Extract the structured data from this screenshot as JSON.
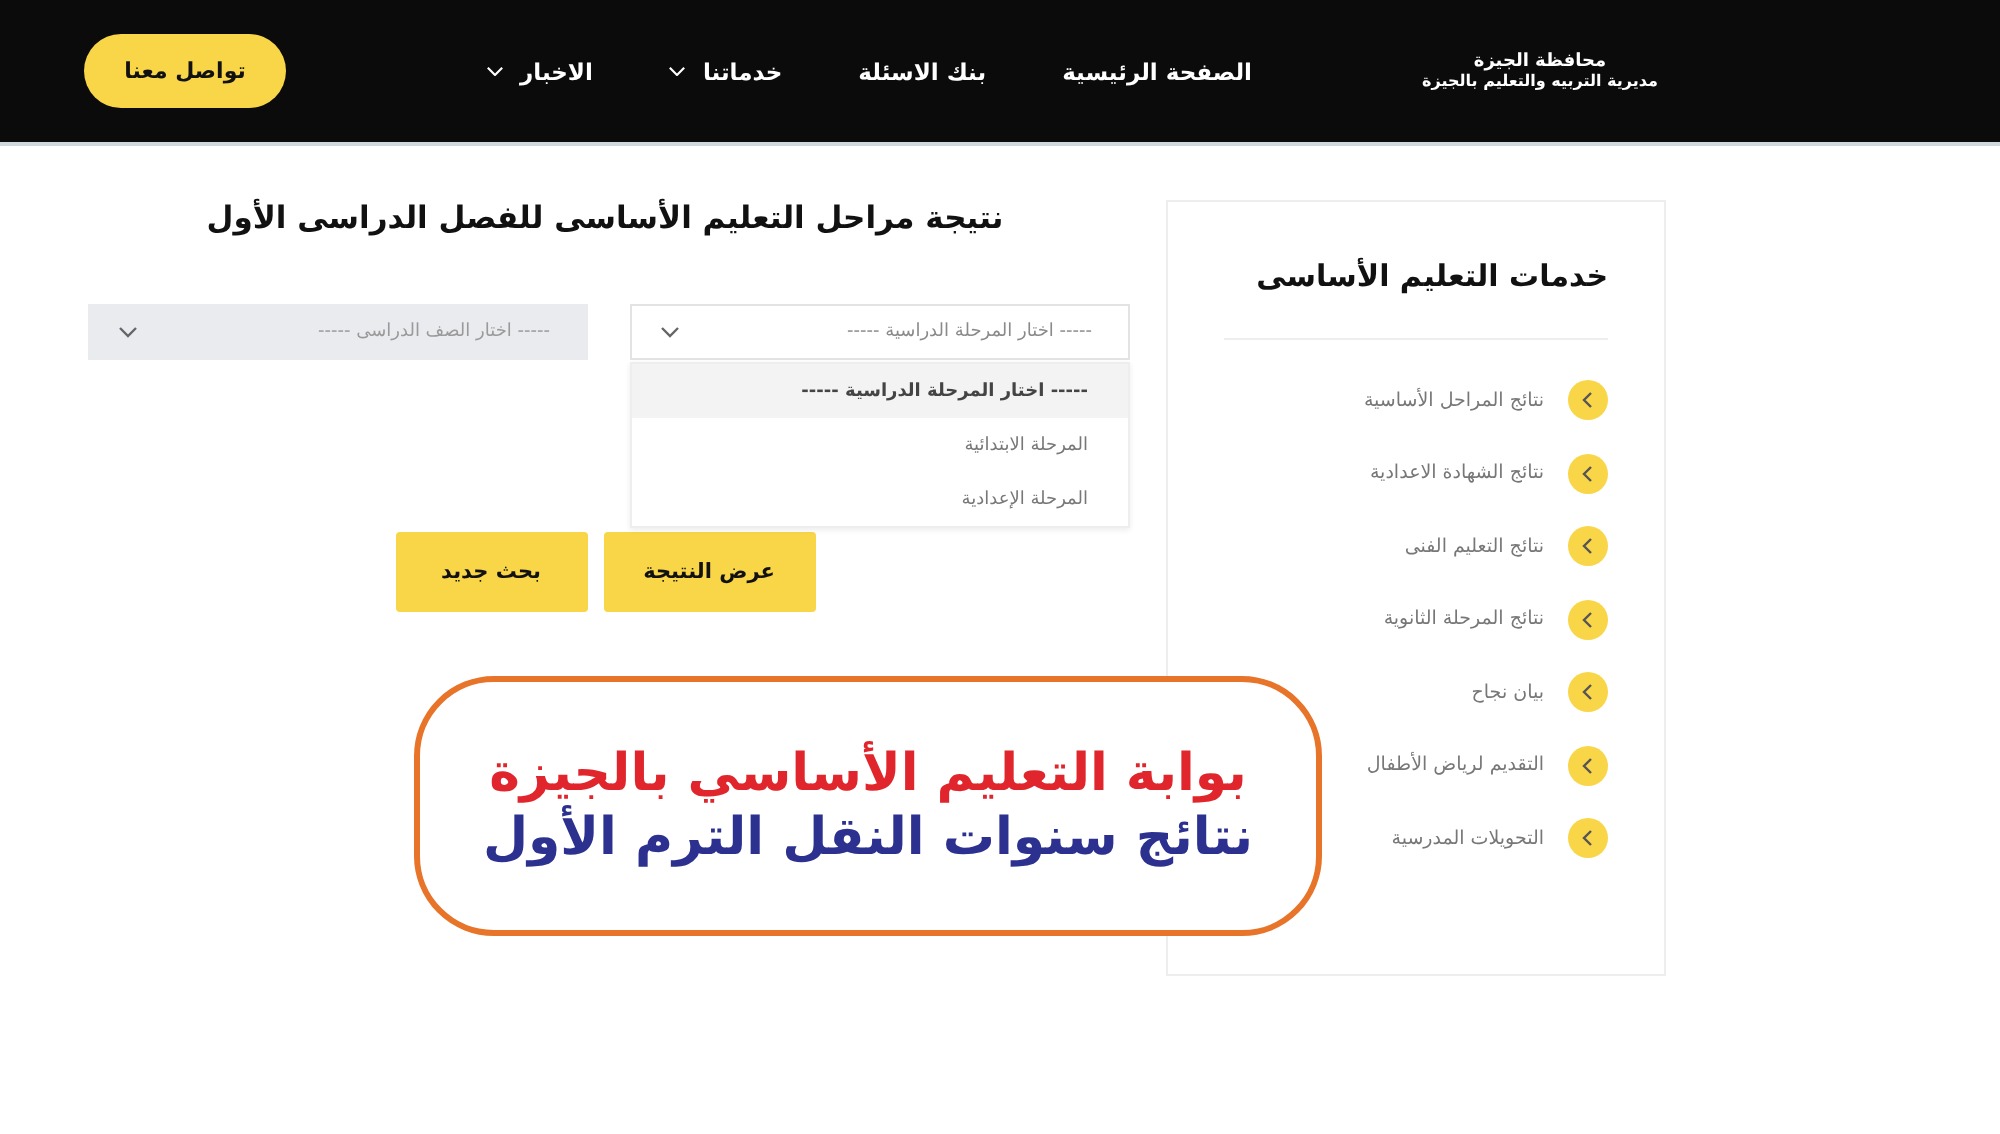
{
  "header": {
    "logo": {
      "line1": "محافظة الجيزة",
      "line2": "مديرية التربيه والتعليم بالجيزة"
    },
    "nav": [
      {
        "label": "الصفحة الرئيسية",
        "has_menu": false
      },
      {
        "label": "بنك الاسئلة",
        "has_menu": false
      },
      {
        "label": "خدماتنا",
        "has_menu": true
      },
      {
        "label": "الاخبار",
        "has_menu": true
      }
    ],
    "contact_button": "تواصل معنا"
  },
  "sidebar": {
    "title": "خدمات التعليم الأساسى",
    "items": [
      "نتائج المراحل الأساسية",
      "نتائج الشهادة الاعدادية",
      "نتائج التعليم الفنى",
      "نتائج المرحلة الثانوية",
      "بيان نجاح",
      "التقديم لرياض الأطفال",
      "التحويلات المدرسية"
    ]
  },
  "main": {
    "title": "نتيجة مراحل التعليم الأساسى للفصل الدراسى الأول",
    "selects": [
      {
        "value": "----- اختار المرحلة الدراسية -----",
        "disabled": false,
        "options": [
          {
            "label": "----- اختار المرحلة الدراسية -----",
            "selected": true
          },
          {
            "label": "المرحلة الابتدائية",
            "selected": false
          },
          {
            "label": "المرحلة الإعدادية",
            "selected": false
          }
        ]
      },
      {
        "value": "----- اختار الصف الدراسى -----",
        "disabled": true
      }
    ],
    "buttons": [
      "عرض النتيجة",
      "بحث جديد"
    ]
  },
  "overlay_banner": {
    "line1": "بوابة التعليم الأساسي بالجيزة",
    "line2": "نتائج سنوات النقل الترم الأول"
  }
}
